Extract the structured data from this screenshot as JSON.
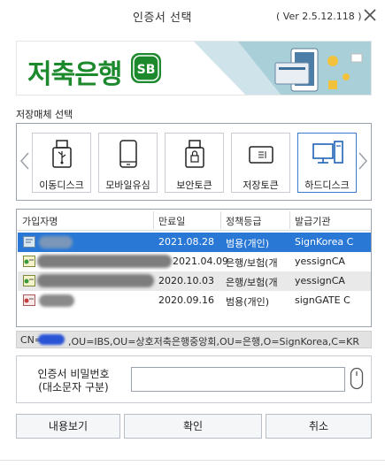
{
  "window": {
    "title": "인증서 선택",
    "version": "( Ver 2.5.12.118 )"
  },
  "banner": {
    "bank_name": "저축은행",
    "logo_text": "SB"
  },
  "storage": {
    "section_label": "저장매체 선택",
    "devices": [
      {
        "label": "이동디스크",
        "icon": "usb-drive-icon"
      },
      {
        "label": "모바일유심",
        "icon": "mobile-phone-icon"
      },
      {
        "label": "보안토큰",
        "icon": "security-token-icon"
      },
      {
        "label": "저장토큰",
        "icon": "storage-token-icon"
      },
      {
        "label": "하드디스크",
        "icon": "hard-disk-monitor-icon",
        "selected": true
      }
    ]
  },
  "cert_list": {
    "headers": [
      "가입자명",
      "만료일",
      "정책등급",
      "발급기관"
    ],
    "rows": [
      {
        "name": "",
        "expiry": "2021.08.28",
        "policy": "범용(개인)",
        "issuer": "SignKorea C",
        "selected": true
      },
      {
        "name": "",
        "expiry": "2021.04.09",
        "policy": "은행/보험(개",
        "issuer": "yessignCA"
      },
      {
        "name": "",
        "expiry": "2020.10.03",
        "policy": "은행/보험(개",
        "issuer": "yessignCA"
      },
      {
        "name": "",
        "expiry": "2020.09.16",
        "policy": "범용(개인)",
        "issuer": "signGATE C"
      }
    ]
  },
  "dn": {
    "prefix": "CN=",
    "rest": ",OU=IBS,OU=상호저축은행중앙회,OU=은행,O=SignKorea,C=KR"
  },
  "password": {
    "label_line1": "인증서 비밀번호",
    "label_line2": "(대소문자 구분)",
    "value": ""
  },
  "buttons": {
    "view": "내용보기",
    "confirm": "확인",
    "cancel": "취소"
  },
  "colors": {
    "accent": "#2a78d6",
    "bank_green": "#1c8a2c",
    "selected_border": "#3d7bd1"
  }
}
